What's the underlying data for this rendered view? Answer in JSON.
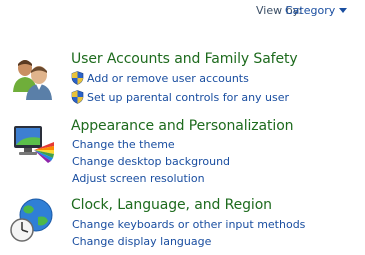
{
  "header": {
    "view_by_label": "View by:",
    "view_by_value": "Category"
  },
  "sections": [
    {
      "title": "User Accounts and Family Safety",
      "icon": "users-icon",
      "links": [
        {
          "label": "Add or remove user accounts",
          "shield": true
        },
        {
          "label": "Set up parental controls for any user",
          "shield": true
        }
      ]
    },
    {
      "title": "Appearance and Personalization",
      "icon": "monitor-paint-icon",
      "links": [
        {
          "label": "Change the theme",
          "shield": false
        },
        {
          "label": "Change desktop background",
          "shield": false
        },
        {
          "label": "Adjust screen resolution",
          "shield": false
        }
      ]
    },
    {
      "title": "Clock, Language, and Region",
      "icon": "globe-clock-icon",
      "links": [
        {
          "label": "Change keyboards or other input methods",
          "shield": false
        },
        {
          "label": "Change display language",
          "shield": false
        }
      ]
    }
  ],
  "colors": {
    "title_green": "#1e6b1e",
    "link_blue": "#1a4ea0",
    "label_gray": "#3c4f66"
  }
}
